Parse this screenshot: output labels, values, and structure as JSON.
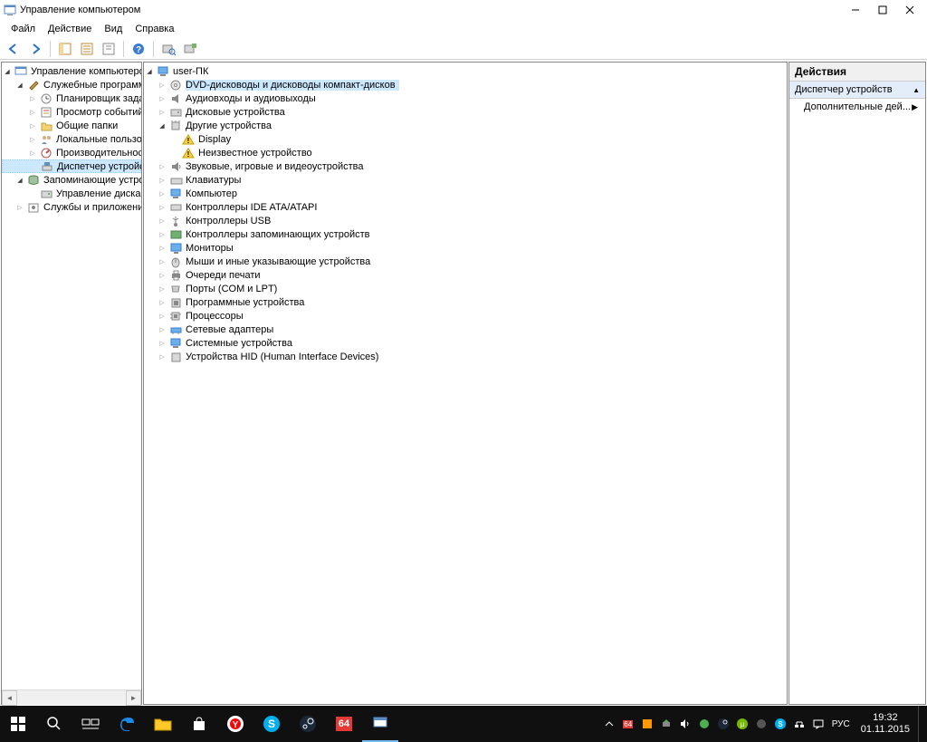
{
  "window": {
    "title": "Управление компьютером"
  },
  "menu": {
    "file": "Файл",
    "action": "Действие",
    "view": "Вид",
    "help": "Справка"
  },
  "left_tree": {
    "root": "Управление компьютером (л",
    "system_tools": "Служебные программы",
    "task_scheduler": "Планировщик заданий",
    "event_viewer": "Просмотр событий",
    "shared_folders": "Общие папки",
    "local_users": "Локальные пользовате",
    "performance": "Производительность",
    "device_manager": "Диспетчер устройств",
    "storage": "Запоминающие устройст",
    "disk_management": "Управление дисками",
    "services_apps": "Службы и приложения"
  },
  "device_tree": {
    "root": "user-ПК",
    "dvd": "DVD-дисководы и дисководы компакт-дисков",
    "audio": "Аудиовходы и аудиовыходы",
    "disk": "Дисковые устройства",
    "other": "Другие устройства",
    "display_unknown": "Display",
    "unknown_device": "Неизвестное устройство",
    "sound_game": "Звуковые, игровые и видеоустройства",
    "keyboards": "Клавиатуры",
    "computer": "Компьютер",
    "ide_atapi": "Контроллеры IDE ATA/ATAPI",
    "usb_controllers": "Контроллеры USB",
    "storage_controllers": "Контроллеры запоминающих устройств",
    "monitors": "Мониторы",
    "mice": "Мыши и иные указывающие устройства",
    "print_queues": "Очереди печати",
    "ports": "Порты (COM и LPT)",
    "software_devices": "Программные устройства",
    "processors": "Процессоры",
    "network_adapters": "Сетевые адаптеры",
    "system_devices": "Системные устройства",
    "hid": "Устройства HID (Human Interface Devices)"
  },
  "actions": {
    "header": "Действия",
    "section": "Диспетчер устройств",
    "more": "Дополнительные дей..."
  },
  "taskbar": {
    "lang": "РУС",
    "time": "19:32",
    "date": "01.11.2015",
    "aida": "64",
    "aida_tray": "64"
  }
}
